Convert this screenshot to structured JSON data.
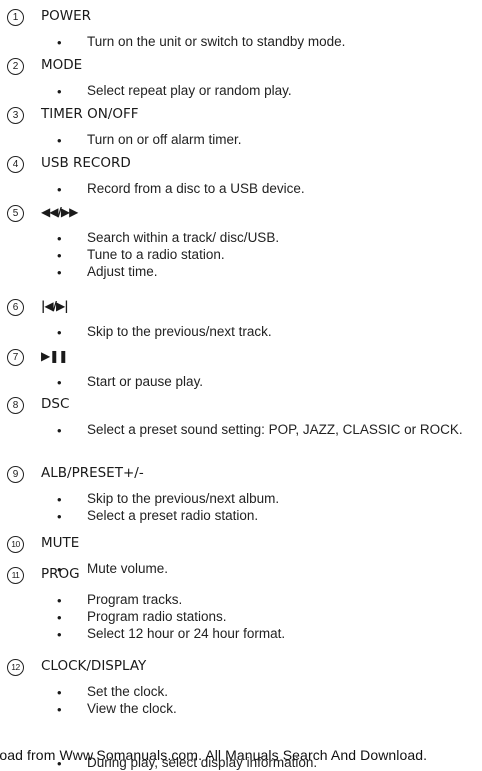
{
  "items": [
    {
      "number": "1",
      "title": "POWER",
      "bullets": [
        "Turn on the unit or switch to standby mode."
      ]
    },
    {
      "number": "2",
      "title": "MODE",
      "bullets": [
        "Select repeat play or random play."
      ]
    },
    {
      "number": "3",
      "title": "TIMER ON/OFF",
      "bullets": [
        "Turn on or off alarm timer."
      ]
    },
    {
      "number": "4",
      "title": "USB RECORD",
      "bullets": [
        "Record from a disc to a USB device."
      ]
    },
    {
      "number": "5",
      "title": "◀◀/▶▶",
      "bullets": [
        "Search within a track/ disc/USB.",
        "Tune to a radio station.",
        "Adjust time."
      ]
    },
    {
      "number": "6",
      "title": "|◀/▶|",
      "bullets": [
        "Skip to the previous/next track."
      ]
    },
    {
      "number": "7",
      "title": "▶❚❚",
      "bullets": [
        "Start or pause play."
      ]
    },
    {
      "number": "8",
      "title": "DSC",
      "bullets": [
        "Select a preset sound setting: POP, JAZZ, CLASSIC or ROCK."
      ]
    },
    {
      "number": "9",
      "title": "ALB/PRESET+/-",
      "bullets": [
        "Skip to the previous/next album.",
        "Select a preset radio station."
      ]
    },
    {
      "number": "10",
      "title": "MUTE",
      "bullets": [
        "Mute volume."
      ]
    },
    {
      "number": "11",
      "title": "PROG",
      "bullets": [
        "Program tracks.",
        "Program radio stations.",
        "Select 12 hour or 24 hour format."
      ]
    },
    {
      "number": "12",
      "title": "CLOCK/DISPLAY",
      "bullets": [
        "Set the clock.",
        "View the clock.",
        "During play, select display information."
      ]
    }
  ],
  "footer": "Download from Www.Somanuals.com. All Manuals Search And Download."
}
